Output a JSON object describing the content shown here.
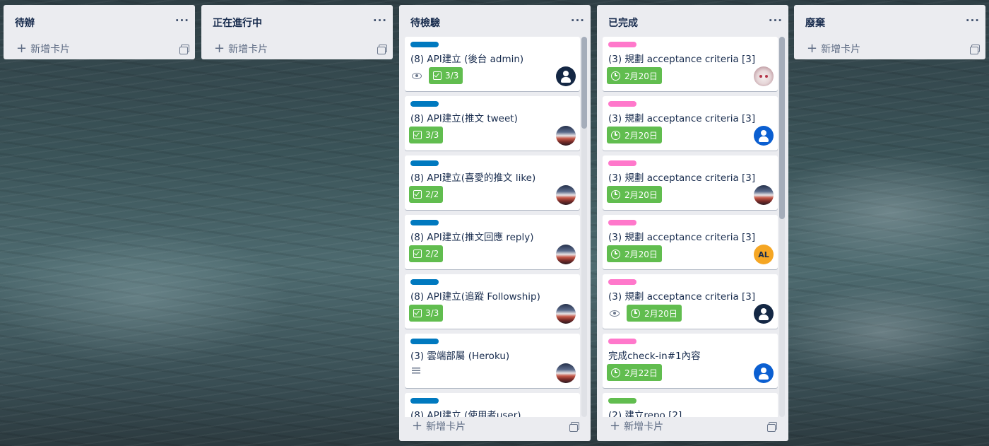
{
  "board": {
    "lists": [
      {
        "title": "待辦",
        "add_label": "新增卡片"
      },
      {
        "title": "正在進行中",
        "add_label": "新增卡片"
      },
      {
        "title": "待檢驗",
        "add_label": "新增卡片",
        "cards": [
          {
            "label_color": "blue",
            "title": "(8) API建立 (後台 admin)",
            "watch": true,
            "checklist": "3/3",
            "avatar": "dark"
          },
          {
            "label_color": "blue",
            "title": "(8) API建立(推文 tweet)",
            "checklist": "3/3",
            "avatar": "photo"
          },
          {
            "label_color": "blue",
            "title": "(8) API建立(喜愛的推文 like)",
            "checklist": "2/2",
            "avatar": "photo"
          },
          {
            "label_color": "blue",
            "title": "(8) API建立(推文回應 reply)",
            "checklist": "2/2",
            "avatar": "photo"
          },
          {
            "label_color": "blue",
            "title": "(8) API建立(追蹤 Followship)",
            "checklist": "3/3",
            "avatar": "photo"
          },
          {
            "label_color": "blue",
            "title": "(3) 雲端部屬 (Heroku)",
            "description": true,
            "avatar": "photo"
          },
          {
            "label_color": "blue",
            "title": "(8) API建立 (使用者user)"
          }
        ]
      },
      {
        "title": "已完成",
        "add_label": "新增卡片",
        "cards": [
          {
            "label_color": "pink",
            "title": "(3) 規劃 acceptance criteria [3]",
            "due": "2月20日",
            "avatar": "anime"
          },
          {
            "label_color": "pink",
            "title": "(3) 規劃 acceptance criteria [3]",
            "due": "2月20日",
            "avatar": "blue"
          },
          {
            "label_color": "pink",
            "title": "(3) 規劃 acceptance criteria [3]",
            "due": "2月20日",
            "avatar": "photo"
          },
          {
            "label_color": "pink",
            "title": "(3) 規劃 acceptance criteria [3]",
            "due": "2月20日",
            "avatar": "initials",
            "avatar_text": "AL"
          },
          {
            "label_color": "pink",
            "title": "(3) 規劃 acceptance criteria [3]",
            "watch": true,
            "due": "2月20日",
            "avatar": "dark"
          },
          {
            "label_color": "pink",
            "title": "完成check-in#1內容",
            "due": "2月22日",
            "avatar": "blue"
          },
          {
            "label_color": "green",
            "title": "(2) 建立repo [2]"
          }
        ]
      },
      {
        "title": "廢棄",
        "add_label": "新增卡片"
      }
    ],
    "menu_glyph": "···",
    "plus_glyph": "+",
    "colors": {
      "list_bg": "#ebecf0",
      "badge_green": "#61bd4f",
      "label_blue": "#0079bf",
      "label_pink": "#ff78cb",
      "label_green": "#61bd4f",
      "text": "#172b4d"
    }
  }
}
